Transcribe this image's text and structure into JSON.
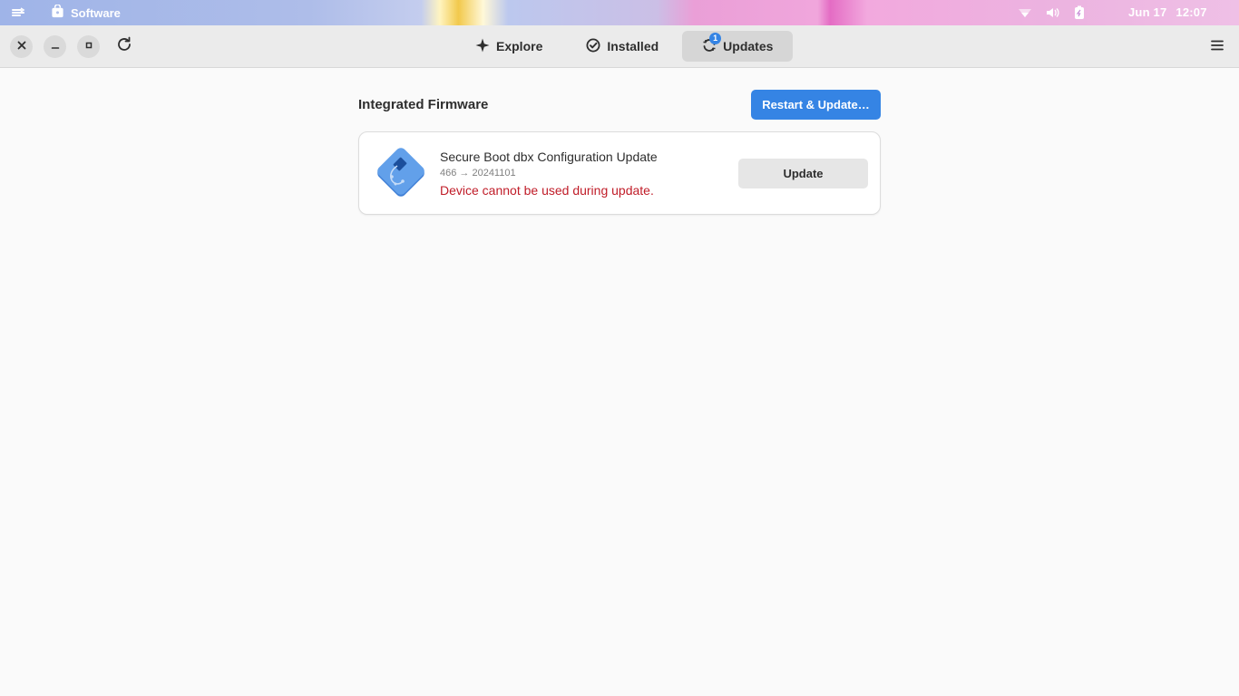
{
  "topbar": {
    "app_name": "Software",
    "date": "Jun 17",
    "time": "12:07",
    "icons": [
      "activities-icon",
      "software-app-icon",
      "network-icon",
      "volume-icon",
      "battery-icon"
    ]
  },
  "headerbar": {
    "tabs": [
      {
        "label": "Explore",
        "icon": "explore-icon",
        "active": false
      },
      {
        "label": "Installed",
        "icon": "installed-check-icon",
        "active": false
      },
      {
        "label": "Updates",
        "icon": "updates-icon",
        "active": true,
        "badge": "1"
      }
    ],
    "buttons": [
      "close-icon",
      "minimize-icon",
      "maximize-icon",
      "refresh-icon",
      "hamburger-menu-icon"
    ]
  },
  "main": {
    "section_title": "Integrated Firmware",
    "restart_label": "Restart & Update…",
    "item": {
      "name": "Secure Boot dbx Configuration Update",
      "version": "466 → 20241101",
      "warning": "Device cannot be used during update.",
      "button_label": "Update"
    }
  },
  "colors": {
    "accent": "#3584e4",
    "warning": "#c01c28",
    "background": "#fafafa",
    "headerbar": "#ebebeb"
  }
}
